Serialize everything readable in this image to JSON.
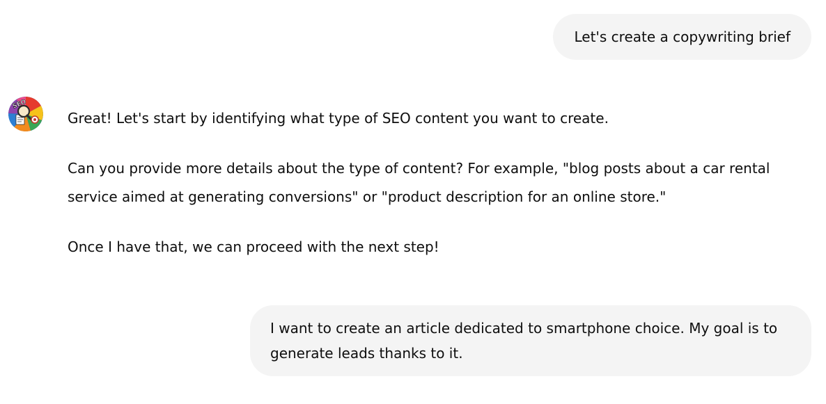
{
  "conversation": {
    "messages": [
      {
        "role": "user",
        "text": "Let's create a copywriting brief"
      },
      {
        "role": "assistant",
        "avatar_icon": "seo-colorful-wheel-avatar",
        "paragraphs": [
          "Great! Let's start by identifying what type of SEO content you want to create.",
          "Can you provide more details about the type of content? For example, \"blog posts about a car rental service aimed at generating conversions\" or \"product description for an online store.\"",
          "Once I have that, we can proceed with the next step!"
        ]
      },
      {
        "role": "user",
        "text": "I want to create an article dedicated to smartphone choice. My goal is to generate leads thanks to it."
      }
    ]
  },
  "colors": {
    "user_bubble_bg": "#f4f4f4",
    "text": "#0d0d0d",
    "background": "#ffffff"
  }
}
